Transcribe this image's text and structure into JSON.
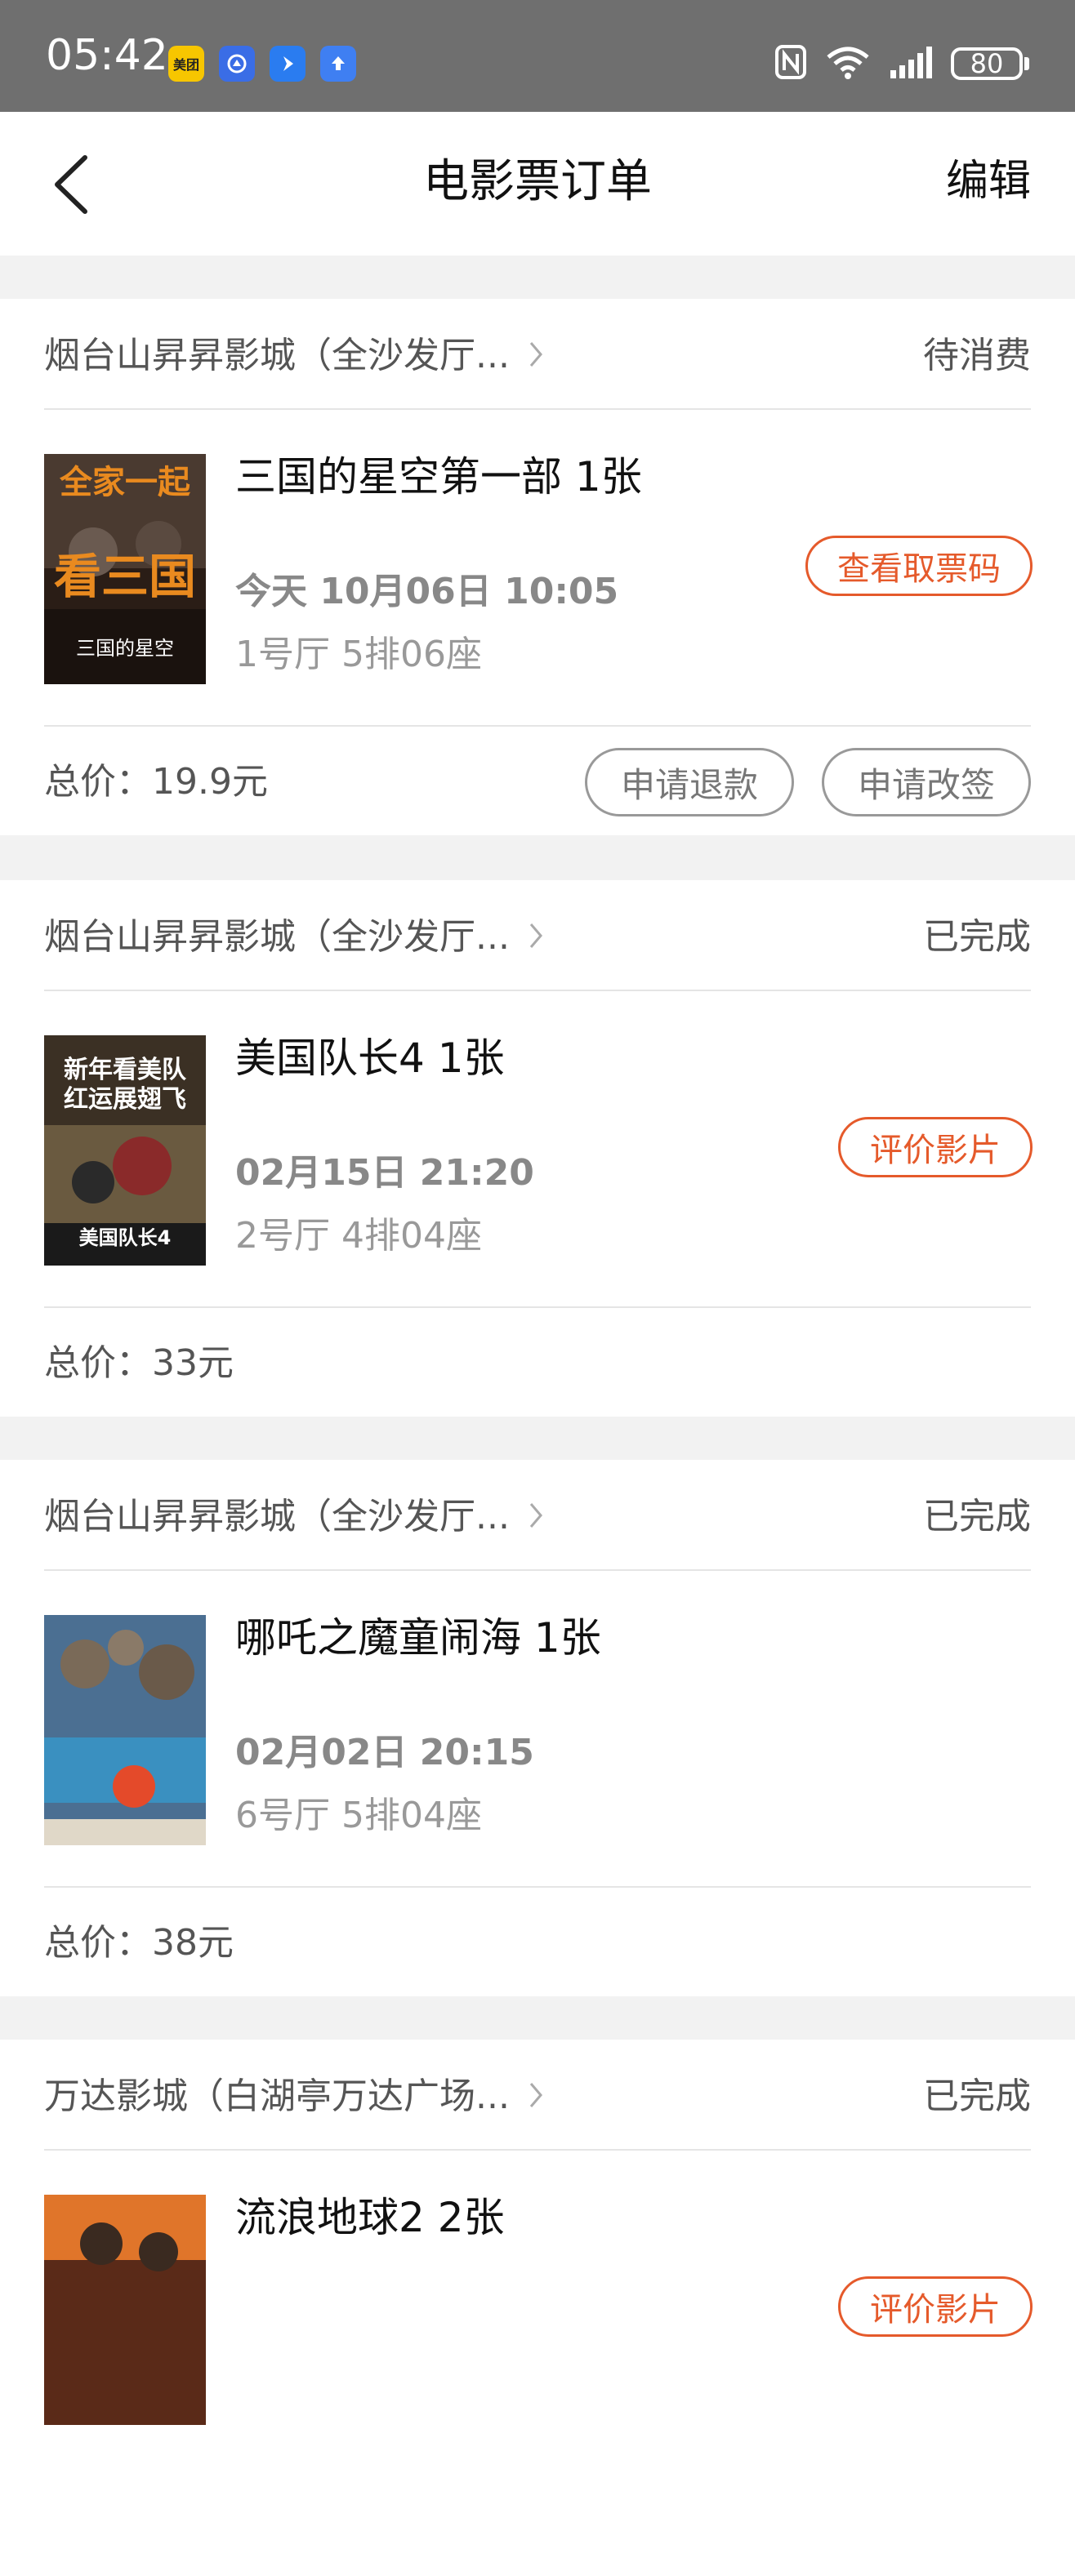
{
  "status_bar": {
    "time": "05:42",
    "apps": [
      {
        "name": "meituan-icon",
        "label": "美团",
        "bg": "#f7c600",
        "fg": "#222"
      },
      {
        "name": "app-blue-icon-1",
        "label": "",
        "bg": "#3a6de6",
        "fg": "#fff"
      },
      {
        "name": "app-blue-icon-2",
        "label": "",
        "bg": "#2a7cf0",
        "fg": "#fff"
      },
      {
        "name": "app-blue-icon-3",
        "label": "",
        "bg": "#3f7ff2",
        "fg": "#fff"
      }
    ],
    "battery": "80"
  },
  "navbar": {
    "title": "电影票订单",
    "edit": "编辑"
  },
  "orders": [
    {
      "cinema": "烟台山昇昇影城（全沙发厅...",
      "status": "待消费",
      "movie": "三国的星空第一部 1张",
      "showtime": "今天 10月06日 10:05",
      "seat": "1号厅 5排06座",
      "action": "查看取票码",
      "total_label": "总价：",
      "total": "19.9元",
      "buttons": [
        "申请退款",
        "申请改签"
      ],
      "poster": {
        "text1": "全家一起",
        "text2": "看三国",
        "text3": "三国的星空",
        "bg": "#2a1d16",
        "accent": "#e98a1f"
      }
    },
    {
      "cinema": "烟台山昇昇影城（全沙发厅...",
      "status": "已完成",
      "movie": "美国队长4 1张",
      "showtime": "02月15日 21:20",
      "seat": "2号厅 4排04座",
      "action": "评价影片",
      "total_label": "总价：",
      "total": "33元",
      "poster": {
        "text1": "新年看美队",
        "text2": "红运展翅飞",
        "text3": "美国队长4",
        "bg": "#3b3024",
        "accent": "#ffffff"
      }
    },
    {
      "cinema": "烟台山昇昇影城（全沙发厅...",
      "status": "已完成",
      "movie": "哪吒之魔童闹海 1张",
      "showtime": "02月02日 20:15",
      "seat": "6号厅 5排04座",
      "total_label": "总价：",
      "total": "38元",
      "poster": {
        "text1": "",
        "text2": "",
        "text3": "",
        "bg": "#4b6f92",
        "accent": "#e44a2a"
      }
    },
    {
      "cinema": "万达影城（白湖亭万达广场...",
      "status": "已完成",
      "movie": "流浪地球2 2张",
      "action": "评价影片",
      "poster": {
        "text1": "",
        "text2": "",
        "text3": "",
        "bg": "#5a2a18",
        "accent": "#e0752a"
      }
    }
  ],
  "colors": {
    "accent": "#e55a2b",
    "statusbar": "#6f6f6f"
  }
}
